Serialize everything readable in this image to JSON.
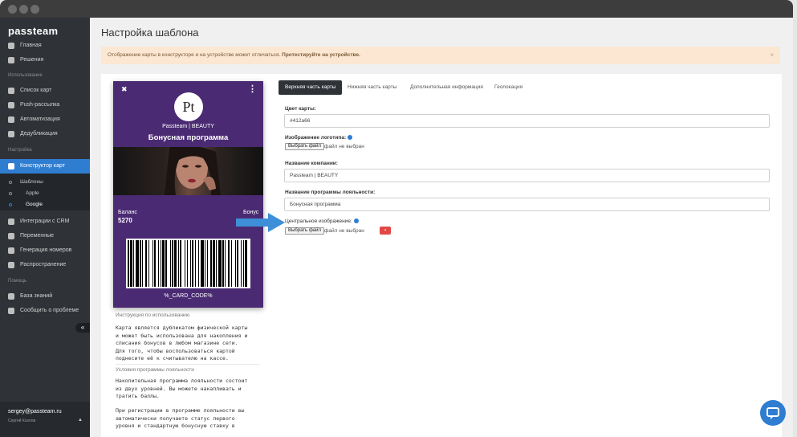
{
  "brand": {
    "logo": "passteam"
  },
  "colors": {
    "accent": "#2e7dd1",
    "card_bg": "#412a66",
    "sidebar_bg": "#2f3237",
    "alert_bg": "#fbe7d2"
  },
  "sidebar": {
    "items_top": [
      {
        "label": "Главная",
        "icon": "home-icon"
      },
      {
        "label": "Решения",
        "icon": "grid-icon"
      }
    ],
    "section_usage": "Использование",
    "items_usage": [
      {
        "label": "Список карт",
        "icon": "list-icon"
      },
      {
        "label": "Push-рассылка",
        "icon": "push-icon"
      },
      {
        "label": "Автоматизация",
        "icon": "automation-icon"
      },
      {
        "label": "Дедубликация",
        "icon": "copy-icon"
      }
    ],
    "section_settings": "Настройка",
    "active_item": {
      "label": "Конструктор карт",
      "icon": "pencil-icon"
    },
    "sub_items": [
      {
        "label": "Шаблоны"
      },
      {
        "label": "Apple"
      },
      {
        "label": "Google"
      }
    ],
    "items_settings": [
      {
        "label": "Интеграции с CRM",
        "icon": "integration-icon"
      },
      {
        "label": "Переменные",
        "icon": "variables-icon"
      },
      {
        "label": "Генерация номеров",
        "icon": "numbers-icon"
      },
      {
        "label": "Распространение",
        "icon": "share-icon"
      }
    ],
    "section_help": "Помощь",
    "items_help": [
      {
        "label": "База знаний",
        "icon": "book-icon"
      },
      {
        "label": "Сообщить о проблеме",
        "icon": "bug-icon"
      }
    ],
    "collapse_icon": "«",
    "user_email": "sergey@passteam.ru",
    "user_name": "Сергей Козлов"
  },
  "page": {
    "title": "Настройка шаблона",
    "alert_text": "Отображение карты в конструкторе и на устройстве может отличаться. ",
    "alert_strong": "Протестируйте на устройстве.",
    "alert_close": "×"
  },
  "card": {
    "logo_text": "Pt",
    "company": "Passteam | BEAUTY",
    "program": "Бонусная программа",
    "balance_label": "Баланс",
    "balance_value": "5270",
    "bonus_label": "Бонус",
    "code": "%_CARD_CODE%",
    "close_icon": "✖",
    "menu_icon": "⋮"
  },
  "description": {
    "usage_title": "Инструкция по использованию",
    "usage_text": "Карта является дубликатом физической карты\nи может быть использована для накопления и\nсписания бонусов в любом магазине сети.\nДля того, чтобы воспользоваться картой\nподнесите её к считывателю на кассе.",
    "terms_title": "Условия программы лояльности",
    "terms_text_1": "Накопительная программа лояльности состоит\nиз двух уровней. Вы можете накапливать и\nтратить баллы.",
    "terms_text_2": "При регистрации в программе лояльности вы\nавтоматически получаете статус первого\nуровня и стандартную бонусную ставку в"
  },
  "tabs": [
    {
      "label": "Верхняя часть карты",
      "active": true
    },
    {
      "label": "Нижняя часть карты",
      "active": false
    },
    {
      "label": "Дополнительная информация",
      "active": false
    },
    {
      "label": "Геолокация",
      "active": false
    }
  ],
  "form": {
    "color_label": "Цвет карты:",
    "color_value": "#412a66",
    "logo_label": "Изображение логотипа:",
    "choose_file": "Выбрать файл",
    "no_file": "файл не выбран",
    "company_label": "Название компании:",
    "company_value": "Passteam | BEAUTY",
    "program_label": "Название программы лояльности:",
    "program_value": "Бонусная программа",
    "center_image_label": "Центральное изображение:",
    "choose_file_2": "Выбрать файл",
    "no_file_2": "файл не выбран"
  }
}
